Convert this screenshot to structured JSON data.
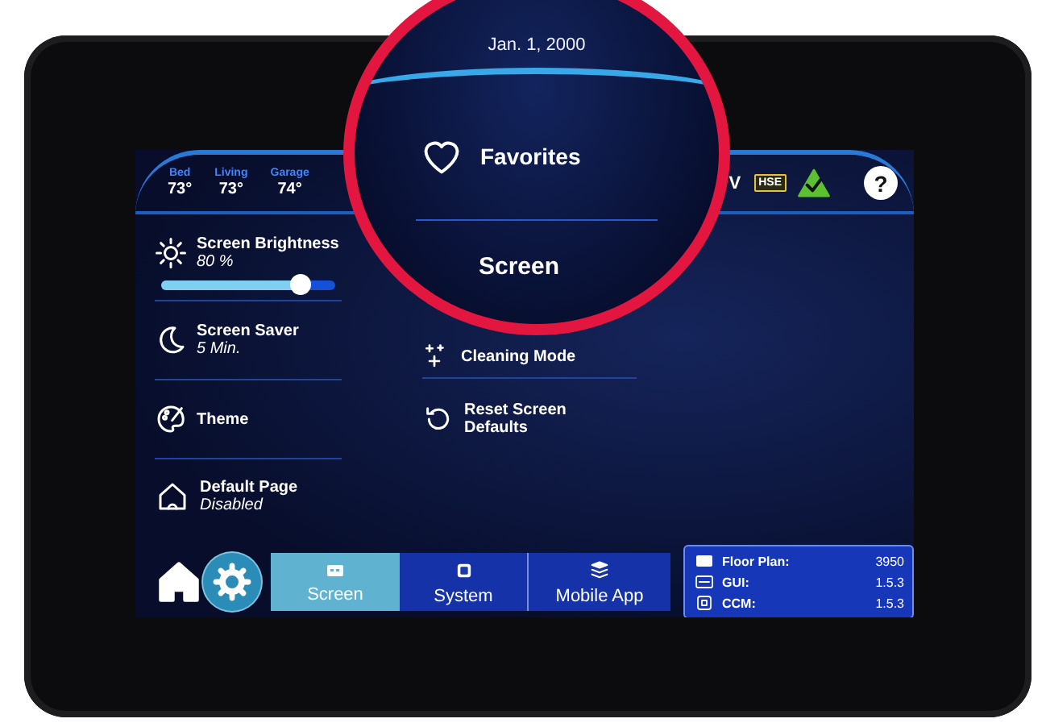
{
  "header": {
    "zones": [
      {
        "name": "Bed",
        "temp": "73°"
      },
      {
        "name": "Living",
        "temp": "73°"
      },
      {
        "name": "Garage",
        "temp": "74°"
      }
    ],
    "status_text": "V",
    "battery_label": "HSE",
    "help_symbol": "?"
  },
  "settings_left": [
    {
      "kind": "slider",
      "title": "Screen Brightness",
      "value": "80 %",
      "level": 0.8
    },
    {
      "kind": "item",
      "title": "Screen Saver",
      "value": "5 Min."
    },
    {
      "kind": "item",
      "title": "Theme"
    },
    {
      "kind": "item",
      "title": "Default Page",
      "value": "Disabled"
    }
  ],
  "settings_right": [
    {
      "title": "Cleaning Mode"
    },
    {
      "title": "Reset Screen Defaults"
    }
  ],
  "nav_tabs": [
    {
      "label": "Screen",
      "selected": true
    },
    {
      "label": "System",
      "selected": false
    },
    {
      "label": "Mobile App",
      "selected": false
    }
  ],
  "versions": [
    {
      "label": "Floor Plan:",
      "value": "3950"
    },
    {
      "label": "GUI:",
      "value": "1.5.3"
    },
    {
      "label": "CCM:",
      "value": "1.5.3"
    }
  ],
  "magnifier": {
    "date": "Jan. 1, 2000",
    "favorites": "Favorites",
    "section_title": "Screen"
  }
}
